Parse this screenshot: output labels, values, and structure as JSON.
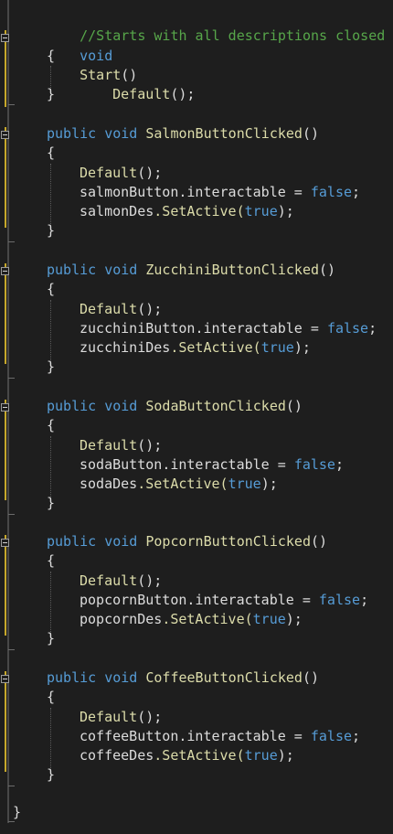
{
  "code": {
    "comment": "//Starts with all descriptions closed",
    "start_method": {
      "kw": "void",
      "name": "Start",
      "parens": "()",
      "body_call": "Default"
    },
    "methods": [
      {
        "mods": "public void",
        "name": "SalmonButtonClicked",
        "button": "salmonButton",
        "des": "salmonDes"
      },
      {
        "mods": "public void",
        "name": "ZucchiniButtonClicked",
        "button": "zucchiniButton",
        "des": "zucchiniDes"
      },
      {
        "mods": "public void",
        "name": "SodaButtonClicked",
        "button": "sodaButton",
        "des": "sodaDes"
      },
      {
        "mods": "public void",
        "name": "PopcornButtonClicked",
        "button": "popcornButton",
        "des": "popcornDes"
      },
      {
        "mods": "public void",
        "name": "CoffeeButtonClicked",
        "button": "coffeeButton",
        "des": "coffeeDes"
      }
    ],
    "tokens": {
      "open_brace": "{",
      "close_brace": "}",
      "parens": "()",
      "default_call": "Default",
      "call_end": "();",
      "interactable": ".interactable = ",
      "false_kw": "false",
      "semicolon": ";",
      "set_active": ".SetActive(",
      "true_kw": "true",
      "set_active_end": ");"
    },
    "class_close": "}"
  }
}
